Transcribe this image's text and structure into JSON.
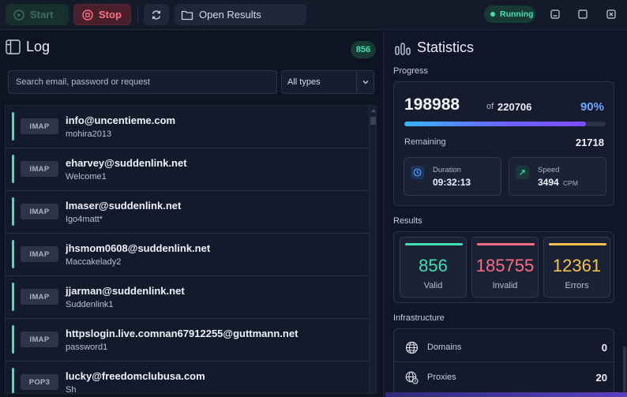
{
  "toolbar": {
    "start_label": "Start",
    "stop_label": "Stop",
    "open_results_label": "Open Results",
    "status": "Running"
  },
  "log": {
    "title": "Log",
    "count": "856",
    "search_placeholder": "Search email, password or request",
    "type_filter": "All types",
    "rows": [
      {
        "protocol": "IMAP",
        "email": "info@uncentieme.com",
        "password": "mohira2013"
      },
      {
        "protocol": "IMAP",
        "email": "eharvey@suddenlink.net",
        "password": "Welcome1"
      },
      {
        "protocol": "IMAP",
        "email": "lmaser@suddenlink.net",
        "password": "Igo4matt*"
      },
      {
        "protocol": "IMAP",
        "email": "jhsmom0608@suddenlink.net",
        "password": "Maccakelady2"
      },
      {
        "protocol": "IMAP",
        "email": "jjarman@suddenlink.net",
        "password": "Suddenlink1"
      },
      {
        "protocol": "IMAP",
        "email": "httpslogin.live.comnan67912255@guttmann.net",
        "password": "password1"
      },
      {
        "protocol": "POP3",
        "email": "lucky@freedomclubusa.com",
        "password": "Sh"
      }
    ]
  },
  "stats": {
    "title": "Statistics",
    "progress": {
      "section_label": "Progress",
      "done": "198988",
      "of_label": "of",
      "total": "220706",
      "percent_label": "90%",
      "fraction": 0.9,
      "remaining_label": "Remaining",
      "remaining": "21718",
      "duration_label": "Duration",
      "duration": "09:32:13",
      "speed_label": "Speed",
      "speed": "3494",
      "speed_unit": "CPM"
    },
    "results": {
      "section_label": "Results",
      "items": [
        {
          "value": "856",
          "label": "Valid",
          "color": "#41dfb1"
        },
        {
          "value": "185755",
          "label": "Invalid",
          "color": "#ff6b81"
        },
        {
          "value": "12361",
          "label": "Errors",
          "color": "#f6c34a"
        }
      ]
    },
    "infrastructure": {
      "section_label": "Infrastructure",
      "items": [
        {
          "label": "Domains",
          "value": "0",
          "icon": "globe-icon"
        },
        {
          "label": "Proxies",
          "value": "20",
          "icon": "proxy-globe-icon"
        }
      ]
    }
  }
}
